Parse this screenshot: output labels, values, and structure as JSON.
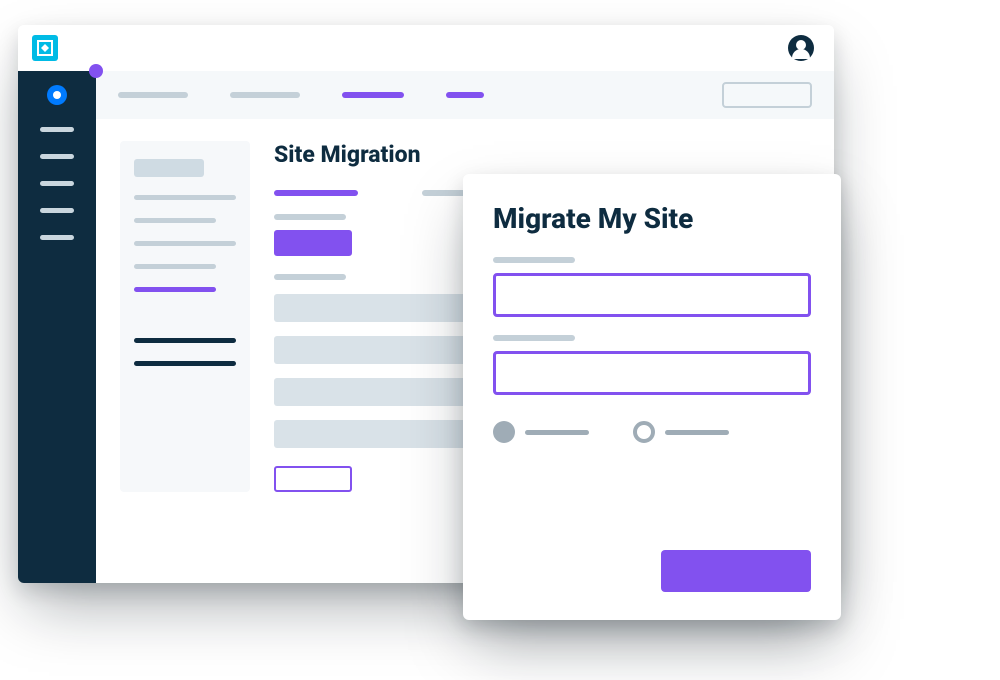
{
  "colors": {
    "accent": "#8251ef",
    "brand": "#00bbe5",
    "dark": "#0e2c40"
  },
  "page": {
    "title": "Site Migration"
  },
  "modal": {
    "title": "Migrate My Site"
  }
}
